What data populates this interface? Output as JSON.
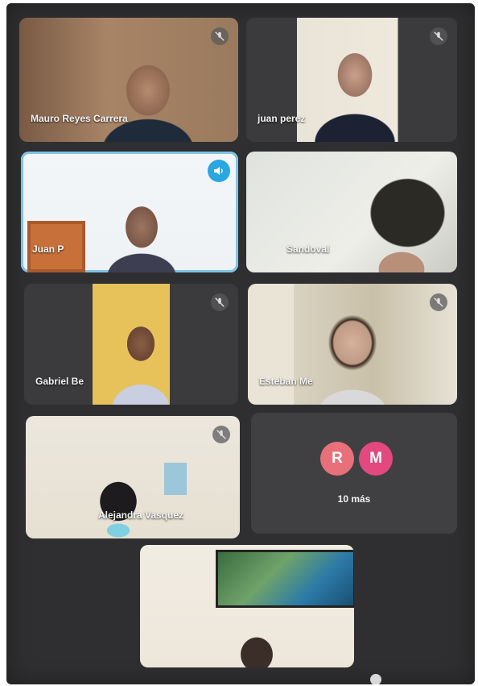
{
  "participants": [
    {
      "name": "Mauro Reyes Carrera"
    },
    {
      "name": "juan perez"
    },
    {
      "name": "Juan P"
    },
    {
      "name": "Sandoval"
    },
    {
      "name": "Gabriel Be"
    },
    {
      "name": "Esteban Me"
    },
    {
      "name": "Alejandra Vasquez"
    },
    {
      "name": ""
    }
  ],
  "more": {
    "avatar_1": "R",
    "avatar_2": "M",
    "label": "10 más",
    "avatar_1_color": "#e8707a",
    "avatar_2_color": "#e3487e"
  },
  "icons": {
    "muted": "mic-off-icon",
    "speaking": "speaker-icon"
  },
  "colors": {
    "background": "#2f2f31",
    "active_border": "#7ec3e6",
    "speaking_badge": "#2aa7e0"
  }
}
